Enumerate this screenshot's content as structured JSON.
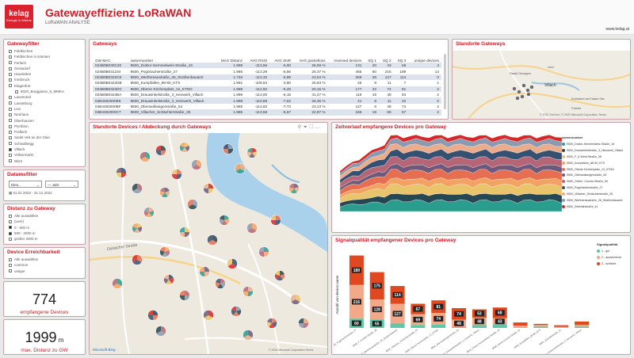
{
  "header": {
    "logo_text": "kelag",
    "logo_sub": "Energie & Wärme",
    "title": "Gatewayeffizienz LoRaWAN",
    "subtitle": "LoRaWAN ANALYSE",
    "url": "www.kelag.at"
  },
  "gateway_filter": {
    "title": "Gatewayfilter",
    "items": [
      {
        "label": "Feldkirchen",
        "checked": false
      },
      {
        "label": "Feldkirchen in Kärnten",
        "checked": false
      },
      {
        "label": "Ferlach",
        "checked": false
      },
      {
        "label": "Gerasdorf",
        "checked": false
      },
      {
        "label": "Hausleiten",
        "checked": false
      },
      {
        "label": "Innsbruck",
        "checked": false
      },
      {
        "label": "Klagenfurt",
        "checked": false
      },
      {
        "label": "9020_Burggasse_8_MMKA",
        "checked": false,
        "indent": true
      },
      {
        "label": "Lavamünd",
        "checked": false
      },
      {
        "label": "Lavantburg",
        "checked": false
      },
      {
        "label": "Linz",
        "checked": false
      },
      {
        "label": "Neuhaus",
        "checked": false
      },
      {
        "label": "Oberhausen",
        "checked": false
      },
      {
        "label": "Pöchlarn",
        "checked": false
      },
      {
        "label": "Podlach",
        "checked": false
      },
      {
        "label": "Sankt Veit an der Glan",
        "checked": false
      },
      {
        "label": "Schwalbegg",
        "checked": false
      },
      {
        "label": "Villach",
        "checked": true
      },
      {
        "label": "Völkermarkt",
        "checked": false
      },
      {
        "label": "Wien",
        "checked": false
      }
    ]
  },
  "date_filter": {
    "title": "Datumsfilter",
    "unit1": "Dies...",
    "unit2": "Jahr",
    "range": "01.01.2022 - 31.12.2022"
  },
  "distance_filter": {
    "title": "Distanz zu Gateway",
    "items": [
      {
        "label": "Alle auswählen",
        "checked": false
      },
      {
        "label": "(Leer)",
        "checked": false
      },
      {
        "label": "0 - 500 m",
        "checked": true
      },
      {
        "label": "500 - 2000 m",
        "checked": true
      },
      {
        "label": "größer 2000 m",
        "checked": false
      }
    ]
  },
  "reach_filter": {
    "title": "Device Erreichbarkeit",
    "items": [
      {
        "label": "Alle auswählen",
        "checked": false
      },
      {
        "label": "common",
        "checked": false
      },
      {
        "label": "unique",
        "checked": false
      }
    ]
  },
  "kpi_devices": {
    "value": "774",
    "label": "empfangene Devices"
  },
  "kpi_distance": {
    "value": "1999",
    "unit": "m",
    "label": "max. Distanz zu GW"
  },
  "gateways": {
    "title": "Gateways",
    "columns": [
      "GW MAC",
      "ownernumber",
      "MAX Distanz",
      "AVG RSSI",
      "AVG SNR",
      "AVG packetloss",
      "received devices",
      "SQ 1",
      "SQ 2",
      "SQ 3",
      "unique devices"
    ],
    "rows": [
      [
        "024B0B030C20",
        "9500_Doktor-Semmelweis-Straße_16",
        "1.998",
        "-113,66",
        "-6,90",
        "26,59 %",
        "131",
        "20",
        "43",
        "68",
        "4"
      ],
      [
        "024B0B031234",
        "9500_Pogöriacherstraße_27",
        "1.966",
        "-113,29",
        "-5,56",
        "26,37 %",
        "465",
        "60",
        "216",
        "189",
        "13"
      ],
      [
        "024B0B0322C8",
        "9500_Werthenaustraße_26_Straßenbauamt",
        "1.746",
        "-113,32",
        "-5,88",
        "23,04 %",
        "269",
        "28",
        "127",
        "114",
        "0"
      ],
      [
        "024B0B0322DB",
        "9500_Kumpfallee_88-90_KTS",
        "1.991",
        "-109,94",
        "-3,80",
        "26,93 %",
        "26",
        "8",
        "11",
        "7",
        "1"
      ],
      [
        "024B0B0323DC",
        "9500_Oberer Kirchenplatz_12_KTNG",
        "1.998",
        "-112,92",
        "-6,25",
        "20,15 %",
        "177",
        "22",
        "74",
        "81",
        "2"
      ],
      [
        "024B0B0324BA",
        "9500_Drauwinkelstraße_3_Hexwerk_Villach",
        "1.999",
        "-113,00",
        "-6,15",
        "31,27 %",
        "119",
        "18",
        "48",
        "53",
        "2"
      ],
      [
        "04B4482000E9",
        "9500_Drauwinkelstraße_3_Heizwerk_Villach",
        "1.999",
        "-110,88",
        "-7,62",
        "25,35 %",
        "41",
        "8",
        "11",
        "22",
        "0"
      ],
      [
        "04B4482000BF",
        "9500_Oberwollanigerstraße_54",
        "1.985",
        "-114,92",
        "-7,73",
        "23,13 %",
        "127",
        "5",
        "48",
        "74",
        "2"
      ],
      [
        "04B4482000C7",
        "9500_Villacher_Schächterstraße_25",
        "1.986",
        "-113,58",
        "-5,67",
        "22,87 %",
        "155",
        "19",
        "69",
        "67",
        "2"
      ]
    ]
  },
  "standorte": {
    "title": "Standorte Gateways",
    "attribution": "© 2022 TomTom, © 2022 Microsoft Corporation Terms",
    "places": [
      "Sankt Georgen",
      "Lind",
      "Villach",
      "Drobollach am Faaker See",
      "Fürnitz"
    ]
  },
  "devices_map": {
    "title": "Standorte Devices / Abdeckung durch Gateways",
    "attribution": "© 2022 Microsoft Corporation Terms",
    "street": "Ossiacher Straße",
    "bing": "Microsoft Bing"
  },
  "zeitverlauf": {
    "title": "Zeitverlauf empfangene Devices pro Gateway",
    "legend_title": "ownernumber",
    "legend": [
      {
        "label": "9500_Doktor-Semmelweis-Straße_16",
        "color": "#2a9d8f"
      },
      {
        "label": "9500_Drauwinkelstraße_3_Heizwerk_Villach",
        "color": "#264653"
      },
      {
        "label": "9500_F_II-Wirth-Straße_38",
        "color": "#e9c46a"
      },
      {
        "label": "9500_Kumpfallee_88-90_KTS",
        "color": "#f4a261"
      },
      {
        "label": "9500_Oberer Kirchenplatz_12_KTNG",
        "color": "#e76f51"
      },
      {
        "label": "9500_Oberwollanigerstraße_54",
        "color": "#6d597a"
      },
      {
        "label": "9500_Ortner- Cruzes-Straße_54",
        "color": "#b56576"
      },
      {
        "label": "9500_Pogöriacherstraße_27",
        "color": "#355070"
      },
      {
        "label": "9500_Villacher_Schächterstraße_25",
        "color": "#eaac8b"
      },
      {
        "label": "9500_Werthenaustraße_26_Straßenbauamt",
        "color": "#8d99ae"
      },
      {
        "label": "9500_Zeleinlinstraße_41",
        "color": "#d62828"
      }
    ]
  },
  "signal": {
    "title": "Signalqualität empfangener Devices pro Gateway",
    "ylabel": "Anzahl von device.name",
    "legend_title": "Signalqualität",
    "legend": [
      {
        "label": "1 - gut",
        "color": "#5cc8a8"
      },
      {
        "label": "2 - ausreichend",
        "color": "#f4a88a"
      },
      {
        "label": "3 - schlecht",
        "color": "#e0481f"
      }
    ]
  },
  "chart_data": {
    "type": "bar",
    "categories": [
      "9500_Pogöriacherstraße_27",
      "9500_F_II-Wirth-Straße_38",
      "9500_Werthenaustraße_26_Straßenbauamt",
      "9500_Villacher_Schächterstraße_25",
      "9500_Oberer Kirchenplatz_12_KTNG",
      "9500_Oberwollanigerstraße_54",
      "9500_Drauwinkelstraße_3_Hexwerk_Villach",
      "9500_Doktor-Semmelweis-Straße_16",
      "9500_Ortner-Cruzes-Straße_54",
      "9500_Kumpfallee_88-90_KTS",
      "9500_Zeleinlinstraße_41",
      "9500_Drauwinkelstraße_3_Heizwerk_Villach"
    ],
    "series": [
      {
        "name": "1 - gut",
        "values": [
          60,
          55,
          28,
          19,
          22,
          5,
          18,
          20,
          3,
          8,
          2,
          8
        ],
        "color": "#5cc8a8"
      },
      {
        "name": "2 - ausreichend",
        "values": [
          216,
          128,
          127,
          69,
          74,
          48,
          48,
          43,
          12,
          11,
          5,
          11
        ],
        "color": "#f4a88a"
      },
      {
        "name": "3 - schlecht",
        "values": [
          189,
          175,
          114,
          67,
          81,
          74,
          53,
          68,
          20,
          7,
          10,
          22
        ],
        "color": "#e0481f"
      }
    ],
    "labels": [
      [
        "60",
        "216",
        "189"
      ],
      [
        "55",
        "128",
        "175"
      ],
      [
        "28",
        "127",
        "114"
      ],
      [
        "19",
        "69",
        "67"
      ],
      [
        "22",
        "74",
        "81"
      ],
      [
        "",
        "48",
        "74"
      ],
      [
        "18",
        "48",
        "53"
      ],
      [
        "20",
        "43",
        "68"
      ],
      [
        "",
        "",
        ""
      ],
      [
        "",
        "",
        ""
      ],
      [
        "",
        "",
        ""
      ],
      [
        "",
        "",
        ""
      ]
    ]
  }
}
